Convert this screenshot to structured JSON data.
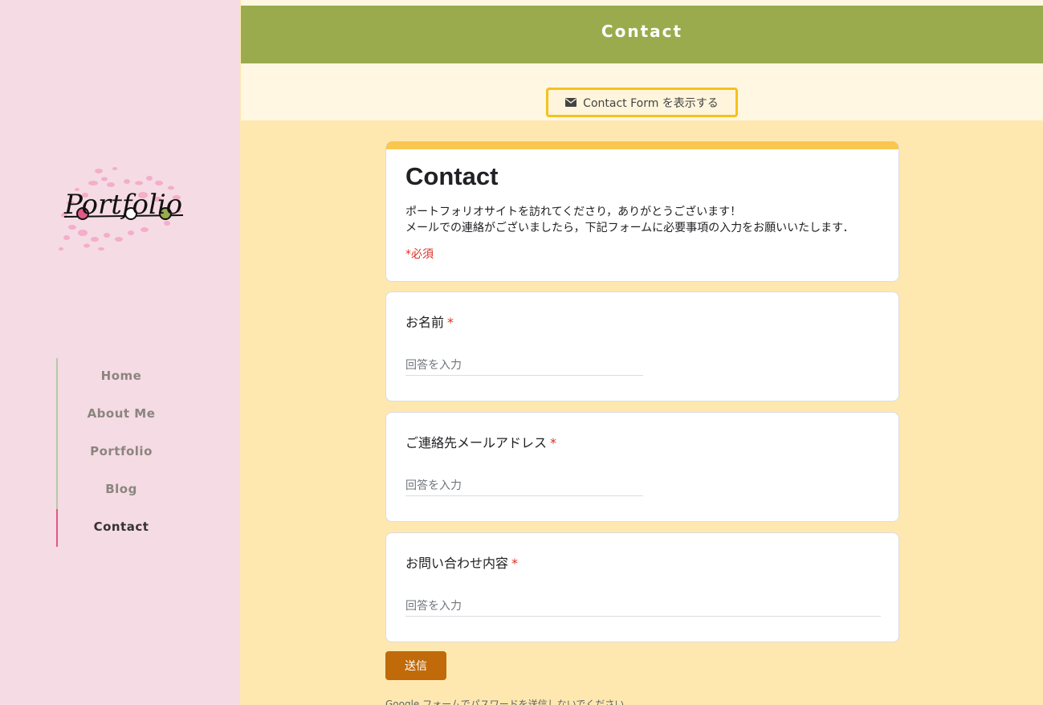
{
  "sidebar": {
    "logo_text": "Portfolio",
    "nav": [
      {
        "label": "Home"
      },
      {
        "label": "About Me"
      },
      {
        "label": "Portfolio"
      },
      {
        "label": "Blog"
      },
      {
        "label": "Contact",
        "active": true
      }
    ]
  },
  "header": {
    "title": "Contact"
  },
  "toggle": {
    "label": "Contact Form を表示する",
    "icon": "envelope-icon"
  },
  "form": {
    "title": "Contact",
    "description_line1": "ポートフォリオサイトを訪れてくださり，ありがとうございます！",
    "description_line2": "メールでの連絡がございましたら，下記フォームに必要事項の入力をお願いいたします．",
    "required_note": "*必須",
    "questions": [
      {
        "label": "お名前",
        "required_mark": "*",
        "placeholder": "回答を入力"
      },
      {
        "label": "ご連絡先メールアドレス",
        "required_mark": "*",
        "placeholder": "回答を入力"
      },
      {
        "label": "お問い合わせ内容",
        "required_mark": "*",
        "placeholder": "回答を入力"
      }
    ],
    "submit_label": "送信",
    "footer_note": "Google フォームでパスワードを送信しないでください。"
  },
  "colors": {
    "sidebar_bg": "#f5dbe3",
    "header_bg": "#9aab4e",
    "page_bg": "#ffe8b0",
    "accent_yellow": "#f9c74f",
    "submit_bg": "#c06a0a",
    "required_red": "#d93025",
    "active_nav_marker": "#e05a8a"
  }
}
